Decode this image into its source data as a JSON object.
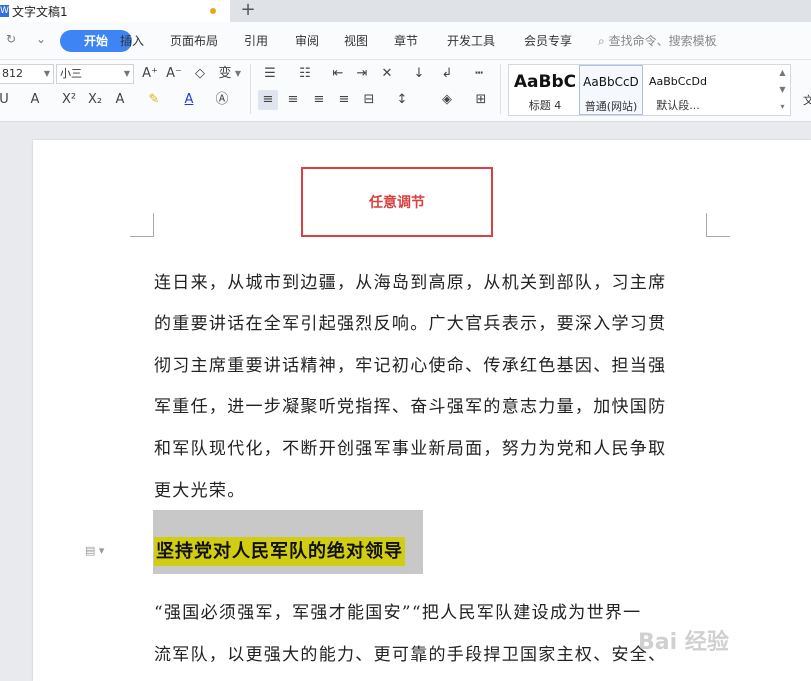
{
  "tabs": {
    "doc_title": "文字文稿1",
    "new_tab": "+"
  },
  "menu": {
    "items": [
      "开始",
      "插入",
      "页面布局",
      "引用",
      "审阅",
      "视图",
      "章节",
      "开发工具",
      "会员专享"
    ],
    "search_placeholder": "查找命令、搜索模板"
  },
  "ribbon": {
    "font_name": "812",
    "font_size": "小三",
    "styles": [
      {
        "sample": "AaBbC",
        "name": "标题 4"
      },
      {
        "sample": "AaBbCcD",
        "name": "普通(网站)"
      },
      {
        "sample": "AaBbCcDd",
        "name": "默认段..."
      }
    ],
    "cut_label": "文"
  },
  "document": {
    "annotation": "任意调节",
    "paragraph1": [
      "连日来，从城市到边疆，从海岛到高原，从机关到部队，习主席",
      "的重要讲话在全军引起强烈反响。广大官兵表示，要深入学习贯",
      "彻习主席重要讲话精神，牢记初心使命、传承红色基因、担当强",
      "军重任，进一步凝聚听党指挥、奋斗强军的意志力量，加快国防",
      "和军队现代化，不断开创强军事业新局面，努力为党和人民争取",
      "更大光荣。"
    ],
    "heading": "坚持党对人民军队的绝对领导",
    "paragraph2": [
      "“强国必须强军，军强才能国安”“把人民军队建设成为世界一",
      "流军队，以更强大的能力、更可靠的手段捍卫国家主权、安全、"
    ]
  },
  "watermark": "Bai 经验",
  "colors": {
    "accent": "#3f84f5",
    "annotation": "#d9413f",
    "highlight": "#d1cd12"
  }
}
